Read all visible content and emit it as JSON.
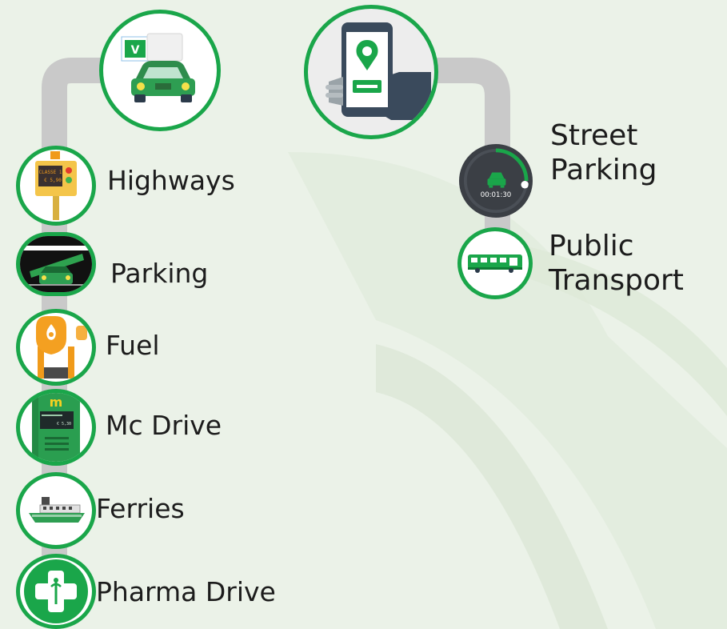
{
  "colors": {
    "brand_green": "#1aa64a",
    "track_gray": "#c9c9c9",
    "background": "#ebf2e8",
    "text": "#1c1c1c"
  },
  "left_column": {
    "header_icon": "car-with-toll-badge-icon",
    "items": [
      {
        "label": "Highways",
        "icon": "toll-booth-icon",
        "toll_screen": "CLASSE 1",
        "toll_price": "€ 5,90"
      },
      {
        "label": "Parking",
        "icon": "parking-barrier-icon"
      },
      {
        "label": "Fuel",
        "icon": "fuel-pump-icon"
      },
      {
        "label": "Mc Drive",
        "icon": "mcdonalds-kiosk-icon",
        "kiosk_letter": "m",
        "kiosk_price": "€ 5,30"
      },
      {
        "label": "Ferries",
        "icon": "ferry-boat-icon"
      },
      {
        "label": "Pharma Drive",
        "icon": "pharmacy-cross-icon"
      }
    ]
  },
  "right_column": {
    "header_icon": "phone-location-pin-icon",
    "items": [
      {
        "label_line1": "Street",
        "label_line2": "Parking",
        "icon": "parking-timer-icon",
        "timer": "00:01:30"
      },
      {
        "label_line1": "Public",
        "label_line2": "Transport",
        "icon": "bus-icon"
      }
    ]
  }
}
